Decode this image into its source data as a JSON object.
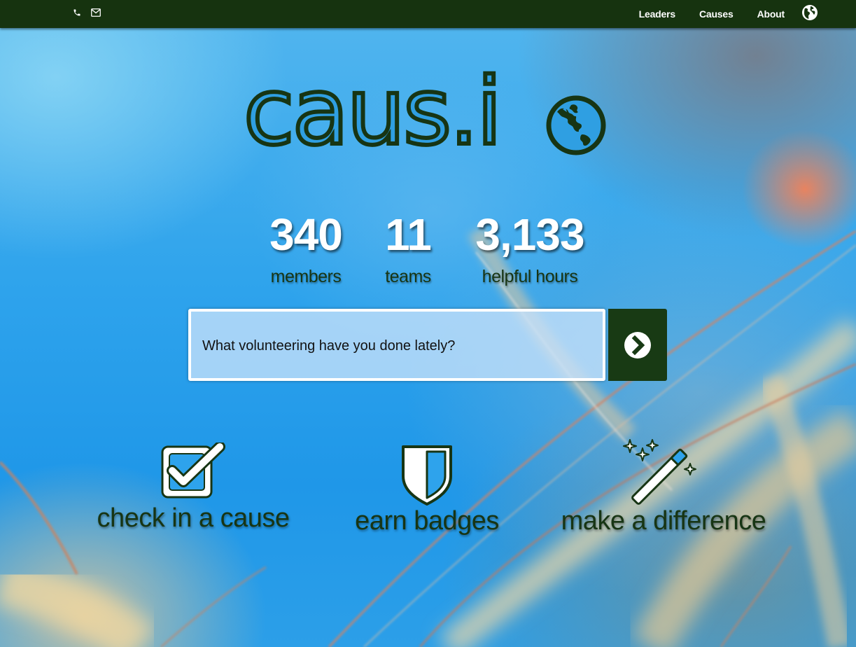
{
  "navbar": {
    "left_icons": [
      "phone-icon",
      "envelope-icon"
    ],
    "links": [
      "Leaders",
      "Causes",
      "About"
    ],
    "right_icon": "globe-icon"
  },
  "logo": {
    "text": "caus.i",
    "icon": "globe-icon"
  },
  "stats": [
    {
      "value": "340",
      "label": "members"
    },
    {
      "value": "11",
      "label": "teams"
    },
    {
      "value": "3,133",
      "label": "helpful hours"
    }
  ],
  "search": {
    "placeholder": "What volunteering have you done lately?",
    "button_icon": "chevron-right-circle-icon"
  },
  "features": [
    {
      "icon": "checkbox-icon",
      "label": "check in a cause"
    },
    {
      "icon": "shield-icon",
      "label": "earn badges"
    },
    {
      "icon": "magic-wand-icon",
      "label": "make a difference"
    }
  ],
  "colors": {
    "navbar": "#16330f",
    "brand_green": "#173514",
    "button": "#183a14",
    "background_blue": "#2ea3ec"
  }
}
